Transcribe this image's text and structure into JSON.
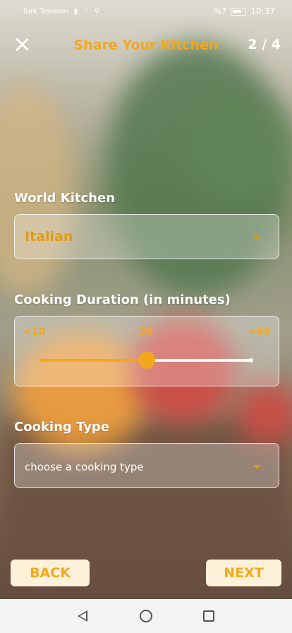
{
  "status_bar": {
    "carrier": "Turk Telekom",
    "battery": "%7",
    "time": "10:37"
  },
  "header": {
    "title": "Share Your Kitchen",
    "step": "2 / 4"
  },
  "world_kitchen": {
    "label": "World Kitchen",
    "value": "Italian"
  },
  "cooking_duration": {
    "label": "Cooking Duration (in minutes)",
    "min_label": "<10",
    "max_label": ">60",
    "current_value": "30",
    "fraction": 0.5
  },
  "cooking_type": {
    "label": "Cooking Type",
    "placeholder": "choose a cooking type"
  },
  "buttons": {
    "back": "BACK",
    "next": "NEXT"
  },
  "colors": {
    "accent": "#f3a81c",
    "button_bg": "#fdf1d9"
  }
}
